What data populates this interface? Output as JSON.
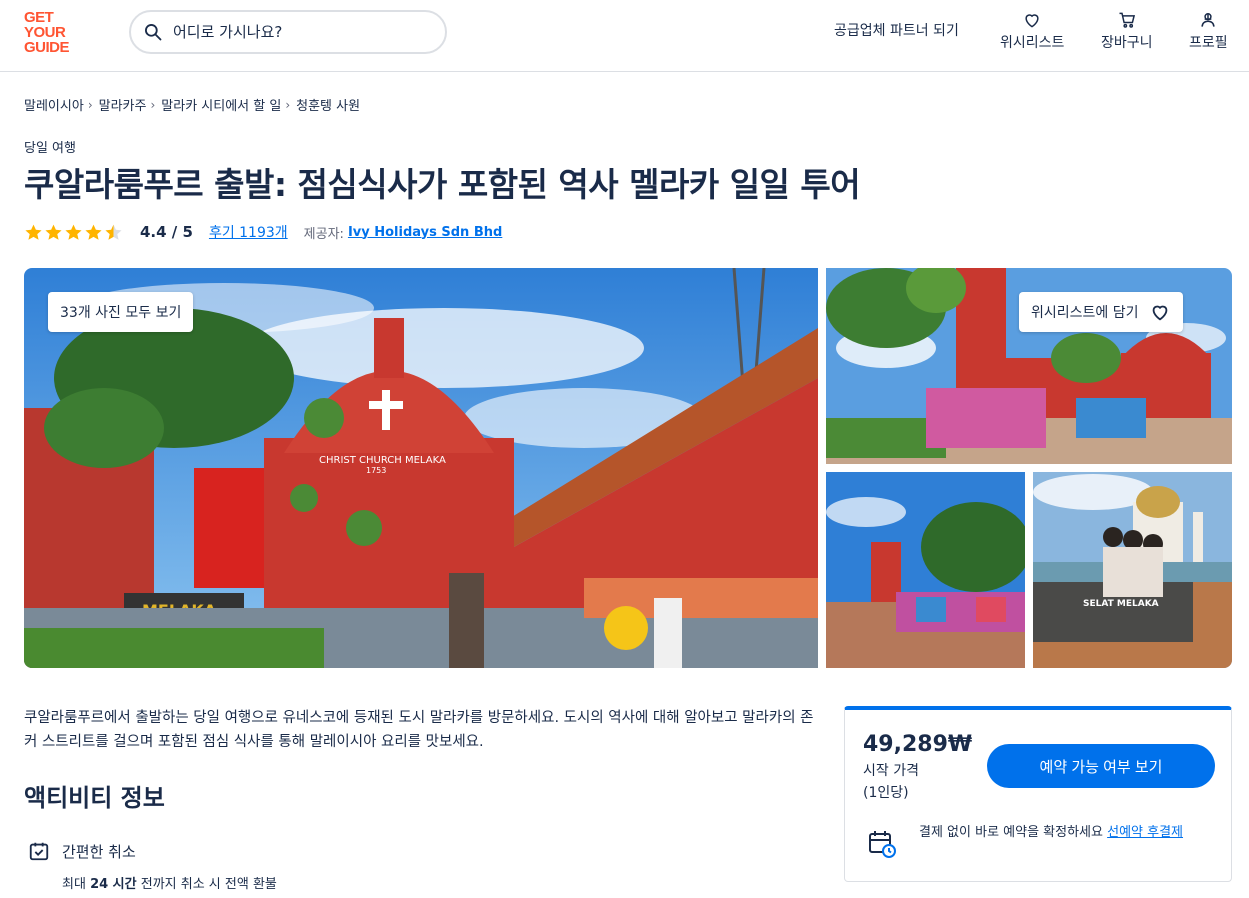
{
  "header": {
    "logo_lines": [
      "GET",
      "YOUR",
      "GUIDE"
    ],
    "search_placeholder": "어디로 가시나요?",
    "partner_link": "공급업체 파트너 되기",
    "nav": [
      {
        "label": "위시리스트",
        "icon": "heart-icon"
      },
      {
        "label": "장바구니",
        "icon": "cart-icon"
      },
      {
        "label": "프로필",
        "icon": "profile-icon"
      }
    ]
  },
  "breadcrumb": [
    "말레이시아",
    "말라카주",
    "말라카 시티에서 할 일",
    "청훈텡 사원"
  ],
  "activity": {
    "category": "당일 여행",
    "title": "쿠알라룸푸르 출발: 점심식사가 포함된 역사 멜라카 일일 투어",
    "rating": "4.4 / 5",
    "rating_score": 4.4,
    "reviews_link": "후기 1193개",
    "provider_label": "제공자:",
    "provider_name": "Ivy Holidays Sdn Bhd"
  },
  "gallery": {
    "view_all_photos": "33개 사진 모두 보기",
    "add_to_wishlist": "위시리스트에 담기",
    "main_sign_text": "CHRIST CHURCH MELAKA",
    "main_sign_year": "1753",
    "main_melaka_sign": "MELAKA",
    "br_sign_text": "SELAT MELAKA"
  },
  "description": "쿠알라룸푸르에서 출발하는 당일 여행으로 유네스코에 등재된 도시 말라카를 방문하세요. 도시의 역사에 대해 알아보고 말라카의 존커 스트리트를 걸으며 포함된 점심 식사를 통해 말레이시아 요리를 맛보세요.",
  "activity_info": {
    "title": "액티비티 정보",
    "features": [
      {
        "title": "간편한 취소",
        "desc_prefix": "최대 ",
        "desc_bold": "24 시간",
        "desc_suffix": " 전까지 취소 시 전액 환불"
      }
    ]
  },
  "booking": {
    "price": "49,289₩",
    "price_from": "시작 가격",
    "price_unit": "(1인당)",
    "check_button": "예약 가능 여부 보기",
    "reserve_text": "결제 없이 바로 예약을 확정하세요 ",
    "reserve_link": "선예약 후결제"
  },
  "colors": {
    "brand": "#ff5533",
    "primary": "#0071eb",
    "text": "#1a2b49",
    "star": "#ffb400"
  }
}
